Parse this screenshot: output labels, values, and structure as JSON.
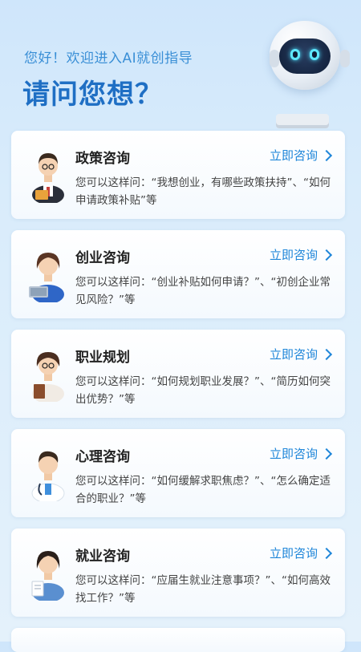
{
  "header": {
    "greeting": "您好！欢迎进入AI就创指导",
    "title": "请问您想？"
  },
  "colors": {
    "accent": "#1f86d9",
    "title": "#1f6fc4",
    "background": "#d9ecfb"
  },
  "cards": [
    {
      "title": "政策咨询",
      "link": "立即咨询",
      "desc": "您可以这样问：“我想创业，有哪些政策扶持”、“如何申请政策补贴”等",
      "avatar_icon": "man-holding-folder-avatar"
    },
    {
      "title": "创业咨询",
      "link": "立即咨询",
      "desc": "您可以这样问：“创业补贴如何申请？”、“初创企业常见风险？”等",
      "avatar_icon": "woman-with-laptop-avatar"
    },
    {
      "title": "职业规划",
      "link": "立即咨询",
      "desc": "您可以这样问：“如何规划职业发展？”、“简历如何突出优势？”等",
      "avatar_icon": "woman-with-book-avatar"
    },
    {
      "title": "心理咨询",
      "link": "立即咨询",
      "desc": "您可以这样问：“如何缓解求职焦虑？”、“怎么确定适合的职业？”等",
      "avatar_icon": "doctor-avatar"
    },
    {
      "title": "就业咨询",
      "link": "立即咨询",
      "desc": "您可以这样问：“应届生就业注意事项？”、“如何高效找工作？”等",
      "avatar_icon": "woman-with-document-avatar"
    }
  ]
}
